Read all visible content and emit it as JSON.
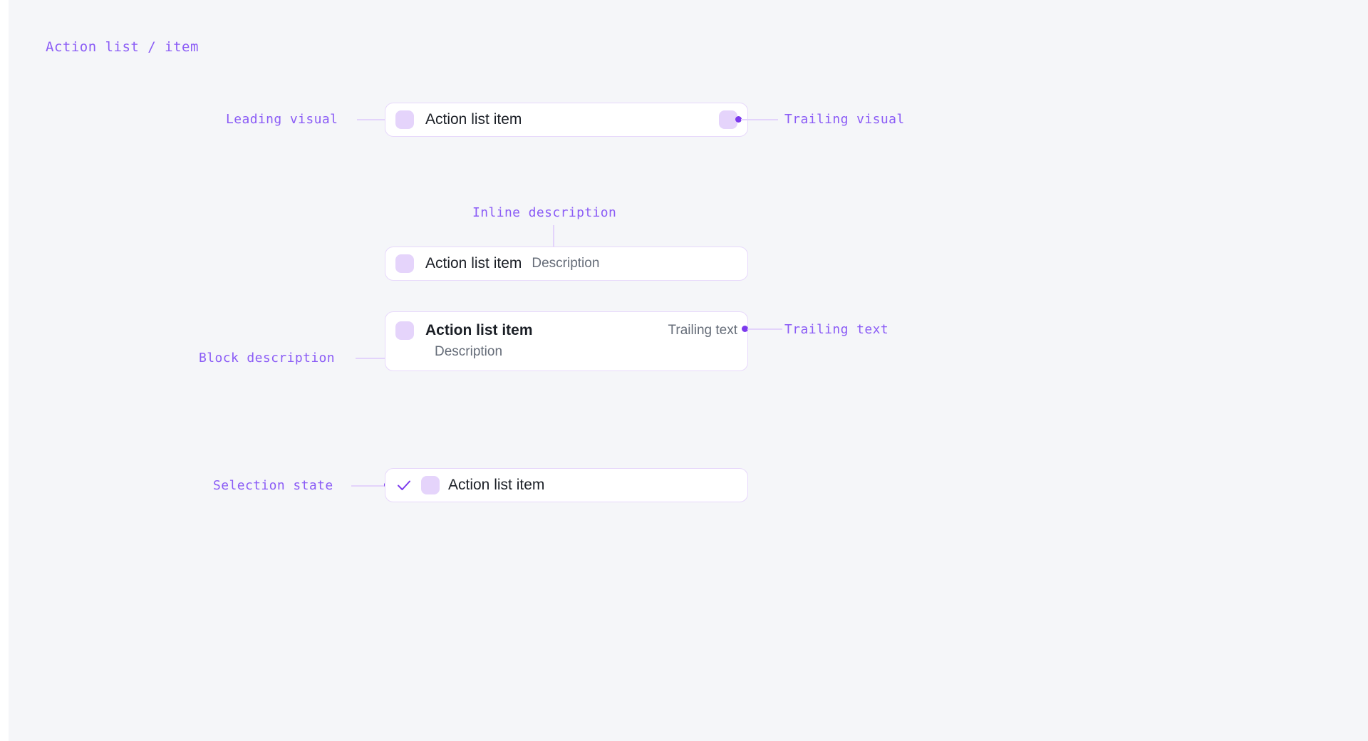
{
  "page": {
    "title": "Action list / item",
    "background_color": "#f5f6f9",
    "accent_color": "#8b5cf6",
    "dot_color": "#7c3aed",
    "connector_color": "#e3d4fb",
    "card_border_color": "#e7d8fb",
    "visual_fill_color": "#e5d4fb"
  },
  "annotations": {
    "leading_visual": "Leading visual",
    "trailing_visual": "Trailing visual",
    "inline_description": "Inline description",
    "block_description": "Block description",
    "trailing_text": "Trailing text",
    "selection_state": "Selection state"
  },
  "cards": [
    {
      "id": "leading-trailing",
      "title": "Action list item",
      "has_leading_visual": true,
      "has_trailing_visual": true
    },
    {
      "id": "inline-description",
      "title": "Action list item",
      "description": "Description",
      "has_leading_visual": true
    },
    {
      "id": "block-description",
      "title": "Action list item",
      "description": "Description",
      "trailing_text": "Trailing text",
      "has_leading_visual": true
    },
    {
      "id": "selection-state",
      "title": "Action list item",
      "has_check": true,
      "check_icon": "check-icon",
      "has_leading_visual": true
    }
  ]
}
